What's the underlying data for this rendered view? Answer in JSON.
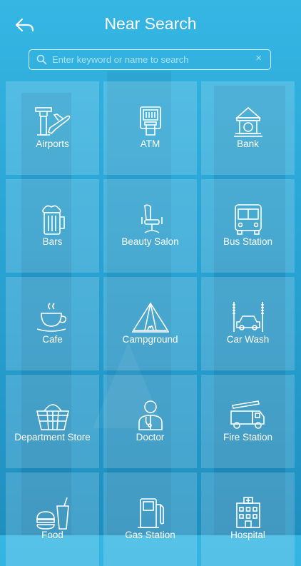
{
  "header": {
    "title": "Near Search"
  },
  "search": {
    "placeholder": "Enter keyword or name to search",
    "value": ""
  },
  "categories": [
    {
      "label": "Airports",
      "icon": "airport-icon"
    },
    {
      "label": "ATM",
      "icon": "atm-icon"
    },
    {
      "label": "Bank",
      "icon": "bank-icon"
    },
    {
      "label": "Bars",
      "icon": "beer-mug-icon"
    },
    {
      "label": "Beauty Salon",
      "icon": "salon-chair-icon"
    },
    {
      "label": "Bus Station",
      "icon": "bus-icon"
    },
    {
      "label": "Cafe",
      "icon": "coffee-cup-icon"
    },
    {
      "label": "Campground",
      "icon": "tent-icon"
    },
    {
      "label": "Car Wash",
      "icon": "car-wash-icon"
    },
    {
      "label": "Department Store",
      "icon": "basket-icon"
    },
    {
      "label": "Doctor",
      "icon": "doctor-icon"
    },
    {
      "label": "Fire Station",
      "icon": "fire-truck-icon"
    },
    {
      "label": "Food",
      "icon": "food-icon"
    },
    {
      "label": "Gas Station",
      "icon": "gas-pump-icon"
    },
    {
      "label": "Hospital",
      "icon": "hospital-icon"
    }
  ]
}
